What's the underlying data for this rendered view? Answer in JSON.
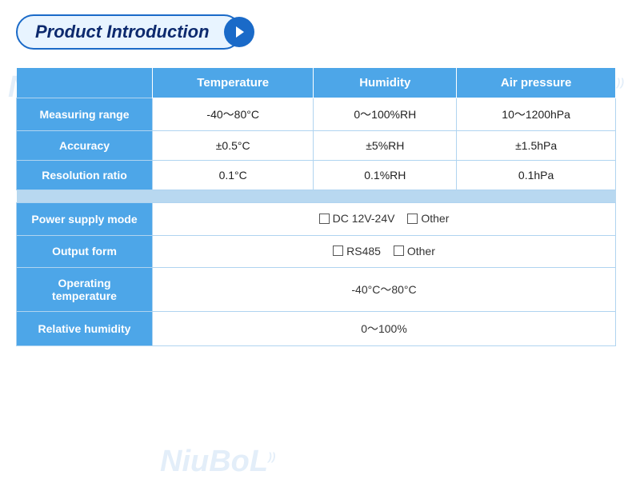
{
  "title": "Product Introduction",
  "watermarks": [
    "NiuBoL",
    "NiuBoL",
    "NiuBoL"
  ],
  "table": {
    "headers": [
      "",
      "Temperature",
      "Humidity",
      "Air pressure"
    ],
    "rows": [
      {
        "label": "Measuring range",
        "temperature": "-40～80°C",
        "humidity": "0～100%RH",
        "air_pressure": "10～1200hPa"
      },
      {
        "label": "Accuracy",
        "temperature": "±0.5°C",
        "humidity": "±5%RH",
        "air_pressure": "±1.5hPa"
      },
      {
        "label": "Resolution ratio",
        "temperature": "0.1°C",
        "humidity": "0.1%RH",
        "air_pressure": "0.1hPa"
      }
    ],
    "bottom_rows": [
      {
        "label": "Power supply mode",
        "value_type": "checkboxes",
        "options": [
          "DC 12V-24V",
          "Other"
        ]
      },
      {
        "label": "Output form",
        "value_type": "checkboxes",
        "options": [
          "RS485",
          "Other"
        ]
      },
      {
        "label": "Operating temperature",
        "value_type": "text",
        "value": "-40°C～80°C"
      },
      {
        "label": "Relative humidity",
        "value_type": "text",
        "value": "0～100%"
      }
    ]
  }
}
